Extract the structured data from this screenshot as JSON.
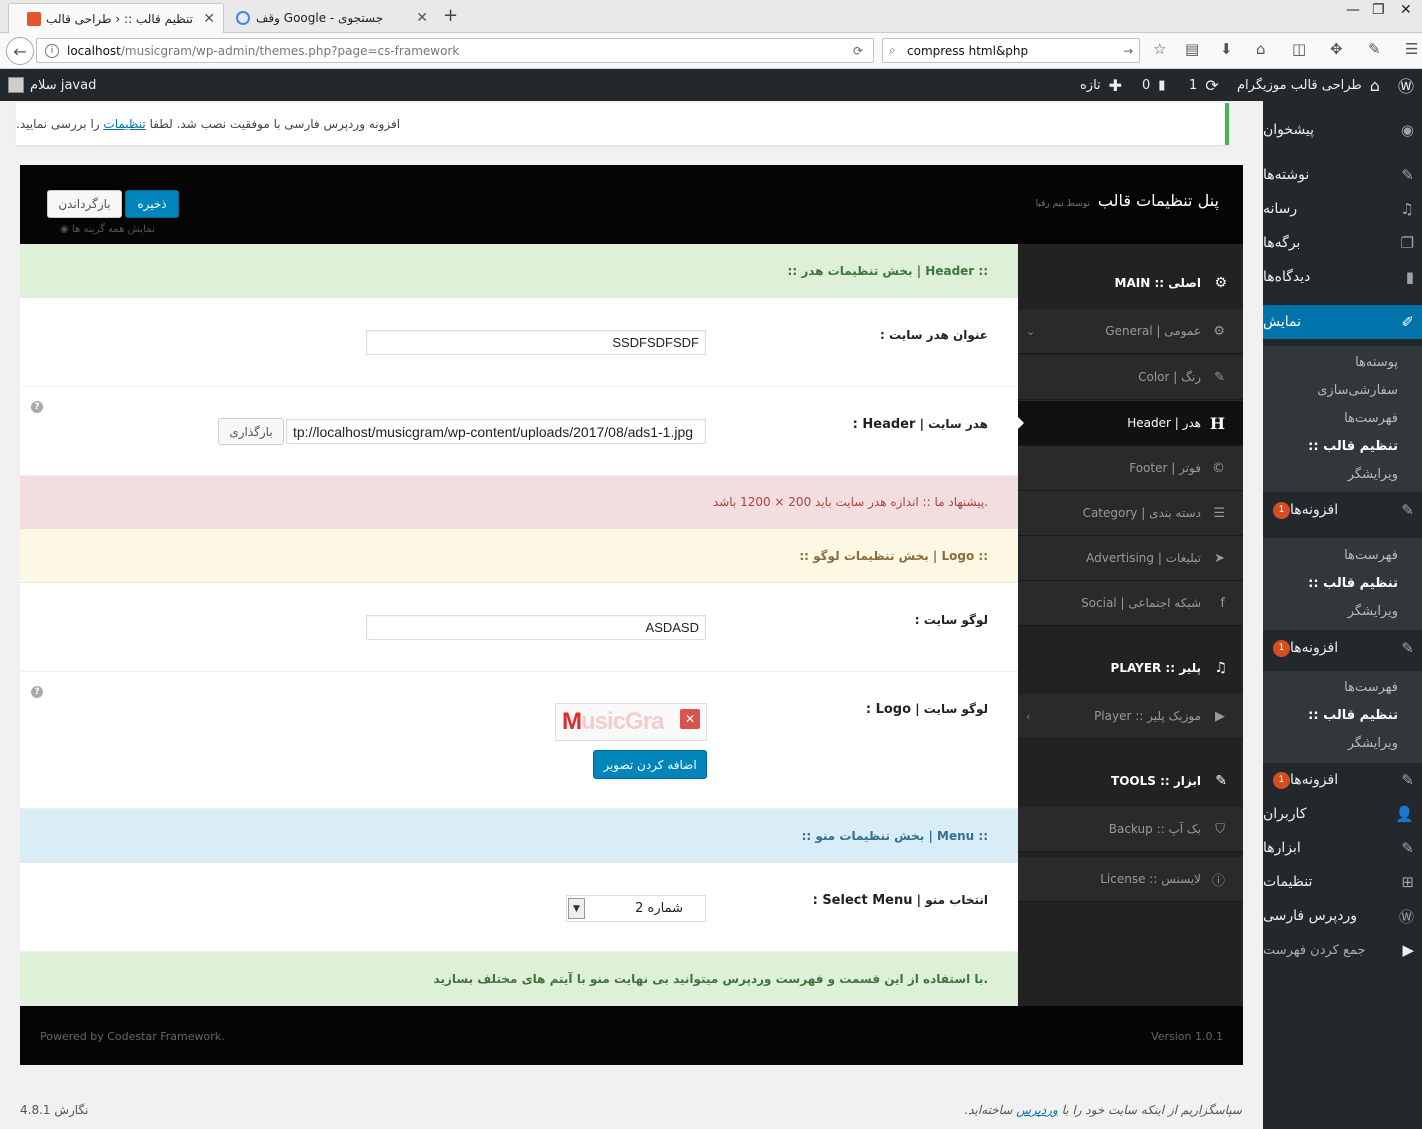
{
  "browser": {
    "tabs": [
      {
        "title": "تنظیم قالب :: ‹ طراحی قالب",
        "active": true
      },
      {
        "title": "وقف Google - جستجوی",
        "active": false
      }
    ],
    "new_tab": "+",
    "url_host": "localhost",
    "url_path": "/musicgram/wp-admin/themes.php?page=cs-framework",
    "search_value": "compress html&php",
    "window_controls": [
      "—",
      "❐",
      "✕"
    ]
  },
  "adminbar": {
    "site_name": "طراحی قالب موزیگرام",
    "updates_count": "1",
    "comments_count": "0",
    "new_label": "تازه",
    "greeting": "سلام javad"
  },
  "notice": {
    "text_before": "افزونه وردپرس فارسی با موفقیت نصب شد. لطفا",
    "link": "تنظیمات",
    "text_after": "را بررسی نمایید."
  },
  "admin_menu": {
    "dashboard": "پیشخوان",
    "posts": "نوشته‌ها",
    "media": "رسانه",
    "pages": "برگه‌ها",
    "comments": "دیدگاه‌ها",
    "appearance": "نمایش",
    "appearance_sub": [
      "پوسته‌ها",
      "سفارشی‌سازی",
      "فهرست‌ها",
      ":: تنظیم قالب",
      "ویرایشگر"
    ],
    "plugins": "افزونه‌ها",
    "plugins_badge": "1",
    "plugin_sub": [
      "فهرست‌ها",
      ":: تنظیم قالب",
      "ویرایشگر"
    ],
    "users": "کاربران",
    "tools": "ابزارها",
    "settings": "تنظیمات",
    "persian_wp": "وردپرس فارسی",
    "collapse": "جمع کردن فهرست"
  },
  "panel": {
    "title": "پنل تنظیمات قالب",
    "subtitle": "توسط تیم رقبا",
    "save": "ذخیره",
    "reset": "بازگرداندن",
    "expand_all": "نمایش همه گزینه ها",
    "footer_left": "Powered by Codestar Framework.",
    "footer_right": "Version 1.0.1"
  },
  "cs_nav": {
    "main_section": "MAIN :: اصلی",
    "general": "General | عمومی",
    "color": "Color | رنگ",
    "header": "Header | هدر",
    "footer": "Footer | فوتر",
    "category": "Category | دسته بندی",
    "advertising": "Advertising | تبلیغات",
    "social": "Social | شبکه اجتماعی",
    "player_section": "PLAYER :: پلیر",
    "player": "Player :: موزیک پلیر",
    "tools_section": "TOOLS :: ابزار",
    "backup": "Backup :: بک آپ",
    "license": "License :: لایسنس"
  },
  "content": {
    "header_heading": ":: بخش تنظیمات هدر | Header ::",
    "site_header_title_label": "عنوان هدر سایت :",
    "site_header_title_value": "SSDFSDFSDF",
    "header_label_fa": "هدر سایت",
    "header_label_en": "Header :",
    "header_url_value": "tp://localhost/musicgram/wp-content/uploads/2017/08/ads1-1.jpg",
    "upload_button": "بارگذاری",
    "suggestion": "پیشنهاد ما :: اندازه هدر سایت باید 200 × 1200 باشد.",
    "logo_heading": ":: بخش تنظیمات لوگو | Logo ::",
    "site_logo_label": "لوگو سایت :",
    "site_logo_value": "ASDASD",
    "logo_label_fa": "لوگو سایت",
    "logo_label_en": "Logo :",
    "logo_preview_first": "M",
    "logo_preview_rest": "usicGra",
    "remove_icon": "✕",
    "add_image": "اضافه کردن تصویر",
    "menu_heading": ":: بخش تنظیمات منو | Menu ::",
    "select_menu_label_fa": "انتخاب منو",
    "select_menu_label_en": "Select Menu :",
    "select_menu_value": "شماره 2",
    "menu_note": "با استفاده از این قسمت و فهرست وردپرس میتوانید بی نهایت منو با آیتم های مختلف بسازید."
  },
  "wp_footer": {
    "thanks_before": "سپاسگزاریم از اینکه سایت خود را با",
    "thanks_link": "وردپرس",
    "thanks_after": "ساخته‌اید.",
    "version": "نگارش 4.8.1"
  }
}
